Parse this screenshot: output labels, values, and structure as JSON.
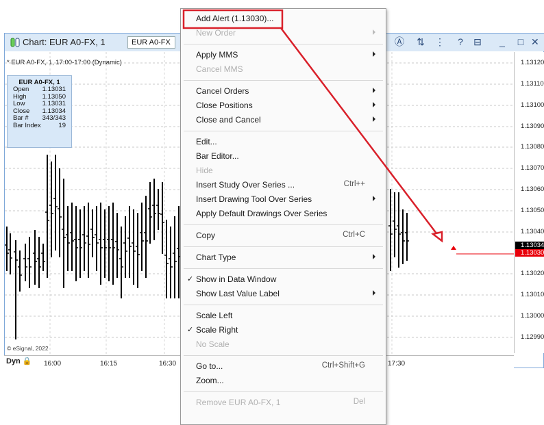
{
  "window": {
    "title": "Chart: EUR A0-FX, 1",
    "symbol_input": "EUR A0-FX",
    "subtitle": "* EUR A0-FX, 1, 17:00-17:00 (Dynamic)",
    "copyright": "© eSignal, 2022",
    "dyn_label": "Dyn",
    "toolbar_icons": [
      "trade-icon",
      "alert-icon",
      "link-icon",
      "more-icon",
      "help-icon",
      "window-icon",
      "minimize-icon",
      "maximize-icon",
      "close-icon"
    ],
    "toolbar_glyphs": [
      "Ⓣ",
      "Ⓐ",
      "⇅",
      "⋮",
      "?",
      "⊟",
      "_",
      "□",
      "✕"
    ]
  },
  "data_window": {
    "header": "EUR A0-FX, 1",
    "rows": [
      {
        "k": "Open",
        "v": "1.13031"
      },
      {
        "k": "High",
        "v": "1.13050"
      },
      {
        "k": "Low",
        "v": "1.13031"
      },
      {
        "k": "Close",
        "v": "1.13034"
      },
      {
        "k": "Bar #",
        "v": "343/343"
      },
      {
        "k": "Bar Index",
        "v": "19"
      }
    ]
  },
  "price_axis": {
    "ticks": [
      "1.13120",
      "1.13110",
      "1.13100",
      "1.13090",
      "1.13080",
      "1.13070",
      "1.13060",
      "1.13050",
      "1.13040",
      "1.13020",
      "1.13010",
      "1.13000",
      "1.12990"
    ],
    "last_value": "1.13034",
    "alert_value": "1.13030",
    "last_color": "#000000",
    "alert_color": "#e8000a"
  },
  "time_axis": {
    "ticks": [
      "16:00",
      "16:15",
      "16:30",
      "17:30"
    ]
  },
  "menu": {
    "items": [
      {
        "label": "Add Alert (1.13030)...",
        "highlight": true
      },
      {
        "label": "New Order",
        "disabled": true,
        "submenu": true
      },
      {
        "sep": true
      },
      {
        "label": "Apply MMS",
        "submenu": true
      },
      {
        "label": "Cancel MMS",
        "disabled": true
      },
      {
        "sep": true
      },
      {
        "label": "Cancel Orders",
        "submenu": true
      },
      {
        "label": "Close Positions",
        "submenu": true
      },
      {
        "label": "Close and Cancel",
        "submenu": true
      },
      {
        "sep": true
      },
      {
        "label": "Edit..."
      },
      {
        "label": "Bar Editor..."
      },
      {
        "label": "Hide",
        "disabled": true
      },
      {
        "label": "Insert Study Over Series ...",
        "shortcut": "Ctrl++"
      },
      {
        "label": "Insert Drawing Tool Over Series",
        "submenu": true
      },
      {
        "label": "Apply Default Drawings Over Series"
      },
      {
        "sep": true
      },
      {
        "label": "Copy",
        "shortcut": "Ctrl+C"
      },
      {
        "sep": true
      },
      {
        "label": "Chart Type",
        "submenu": true
      },
      {
        "sep": true
      },
      {
        "label": "Show in Data Window",
        "checked": true
      },
      {
        "label": "Show Last Value Label",
        "submenu": true
      },
      {
        "sep": true
      },
      {
        "label": "Scale Left"
      },
      {
        "label": "Scale Right",
        "checked": true
      },
      {
        "label": "No Scale",
        "disabled": true
      },
      {
        "sep": true
      },
      {
        "label": "Go to...",
        "shortcut": "Ctrl+Shift+G"
      },
      {
        "label": "Zoom..."
      },
      {
        "sep": true
      },
      {
        "label": "Remove EUR A0-FX, 1",
        "shortcut": "Del",
        "disabled": true
      }
    ]
  },
  "annotation": {
    "color": "#d9202a"
  }
}
